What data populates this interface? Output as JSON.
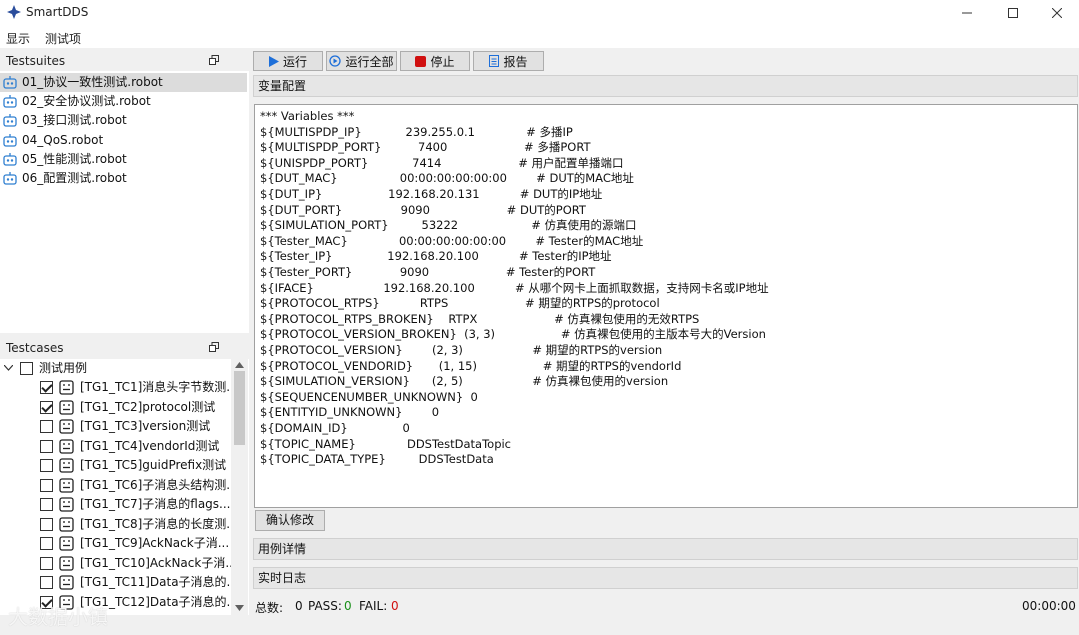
{
  "window": {
    "title": "SmartDDS"
  },
  "menu": [
    "显示",
    "测试项"
  ],
  "testsuites": {
    "header": "Testsuites",
    "items": [
      "01_协议一致性测试.robot",
      "02_安全协议测试.robot",
      "03_接口测试.robot",
      "04_QoS.robot",
      "05_性能测试.robot",
      "06_配置测试.robot"
    ]
  },
  "testcases": {
    "header": "Testcases",
    "root": "测试用例",
    "items": [
      {
        "label": "[TG1_TC1]消息头字节数测...",
        "checked": true
      },
      {
        "label": "[TG1_TC2]protocol测试",
        "checked": true
      },
      {
        "label": "[TG1_TC3]version测试",
        "checked": false
      },
      {
        "label": "[TG1_TC4]vendorId测试",
        "checked": false
      },
      {
        "label": "[TG1_TC5]guidPrefix测试",
        "checked": false
      },
      {
        "label": "[TG1_TC6]子消息头结构测...",
        "checked": false
      },
      {
        "label": "[TG1_TC7]子消息的flags...",
        "checked": false
      },
      {
        "label": "[TG1_TC8]子消息的长度测...",
        "checked": false
      },
      {
        "label": "[TG1_TC9]AckNack子消...",
        "checked": false
      },
      {
        "label": "[TG1_TC10]AckNack子消...",
        "checked": false
      },
      {
        "label": "[TG1_TC11]Data子消息的...",
        "checked": false
      },
      {
        "label": "[TG1_TC12]Data子消息的...",
        "checked": true
      }
    ]
  },
  "toolbar": {
    "run": "运行",
    "run_all": "运行全部",
    "stop": "停止",
    "report": "报告"
  },
  "sections": {
    "variables": "变量配置",
    "case_detail": "用例详情",
    "live_log": "实时日志"
  },
  "editor_lines": [
    "*** Variables ***",
    "${MULTISPDP_IP}            239.255.0.1              # 多播IP",
    "${MULTISPDP_PORT}          7400                     # 多播PORT",
    "${UNISPDP_PORT}            7414                     # 用户配置单播端口",
    "${DUT_MAC}                 00:00:00:00:00:00        # DUT的MAC地址",
    "${DUT_IP}                  192.168.20.131           # DUT的IP地址",
    "${DUT_PORT}                9090                     # DUT的PORT",
    "${SIMULATION_PORT}         53222                    # 仿真使用的源端口",
    "${Tester_MAC}              00:00:00:00:00:00        # Tester的MAC地址",
    "${Tester_IP}               192.168.20.100           # Tester的IP地址",
    "${Tester_PORT}             9090                     # Tester的PORT",
    "${IFACE}                   192.168.20.100           # 从哪个网卡上面抓取数据，支持网卡名或IP地址",
    "${PROTOCOL_RTPS}           RTPS                     # 期望的RTPS的protocol",
    "${PROTOCOL_RTPS_BROKEN}    RTPX                     # 仿真裸包使用的无效RTPS",
    "${PROTOCOL_VERSION_BROKEN}  (3, 3)                  # 仿真裸包使用的主版本号大的Version",
    "${PROTOCOL_VERSION}        (2, 3)                   # 期望的RTPS的version",
    "${PROTOCOL_VENDORID}       (1, 15)                  # 期望的RTPS的vendorId",
    "${SIMULATION_VERSION}      (2, 5)                   # 仿真裸包使用的version",
    "${SEQUENCENUMBER_UNKNOWN}  0",
    "${ENTITYID_UNKNOWN}        0",
    "${DOMAIN_ID}               0",
    "${TOPIC_NAME}              DDSTestDataTopic",
    "${TOPIC_DATA_TYPE}         DDSTestData"
  ],
  "confirm_button": "确认修改",
  "status": {
    "total_label": "总数:",
    "total": "0",
    "pass_label": "PASS:",
    "pass": "0",
    "fail_label": "FAIL:",
    "fail": "0",
    "time": "00:00:00"
  },
  "colors": {
    "pass": "#1a8f1a",
    "fail": "#d01010",
    "run_icon": "#1e6fd9",
    "stop_icon": "#d01010"
  },
  "watermark": "大数据小镇"
}
